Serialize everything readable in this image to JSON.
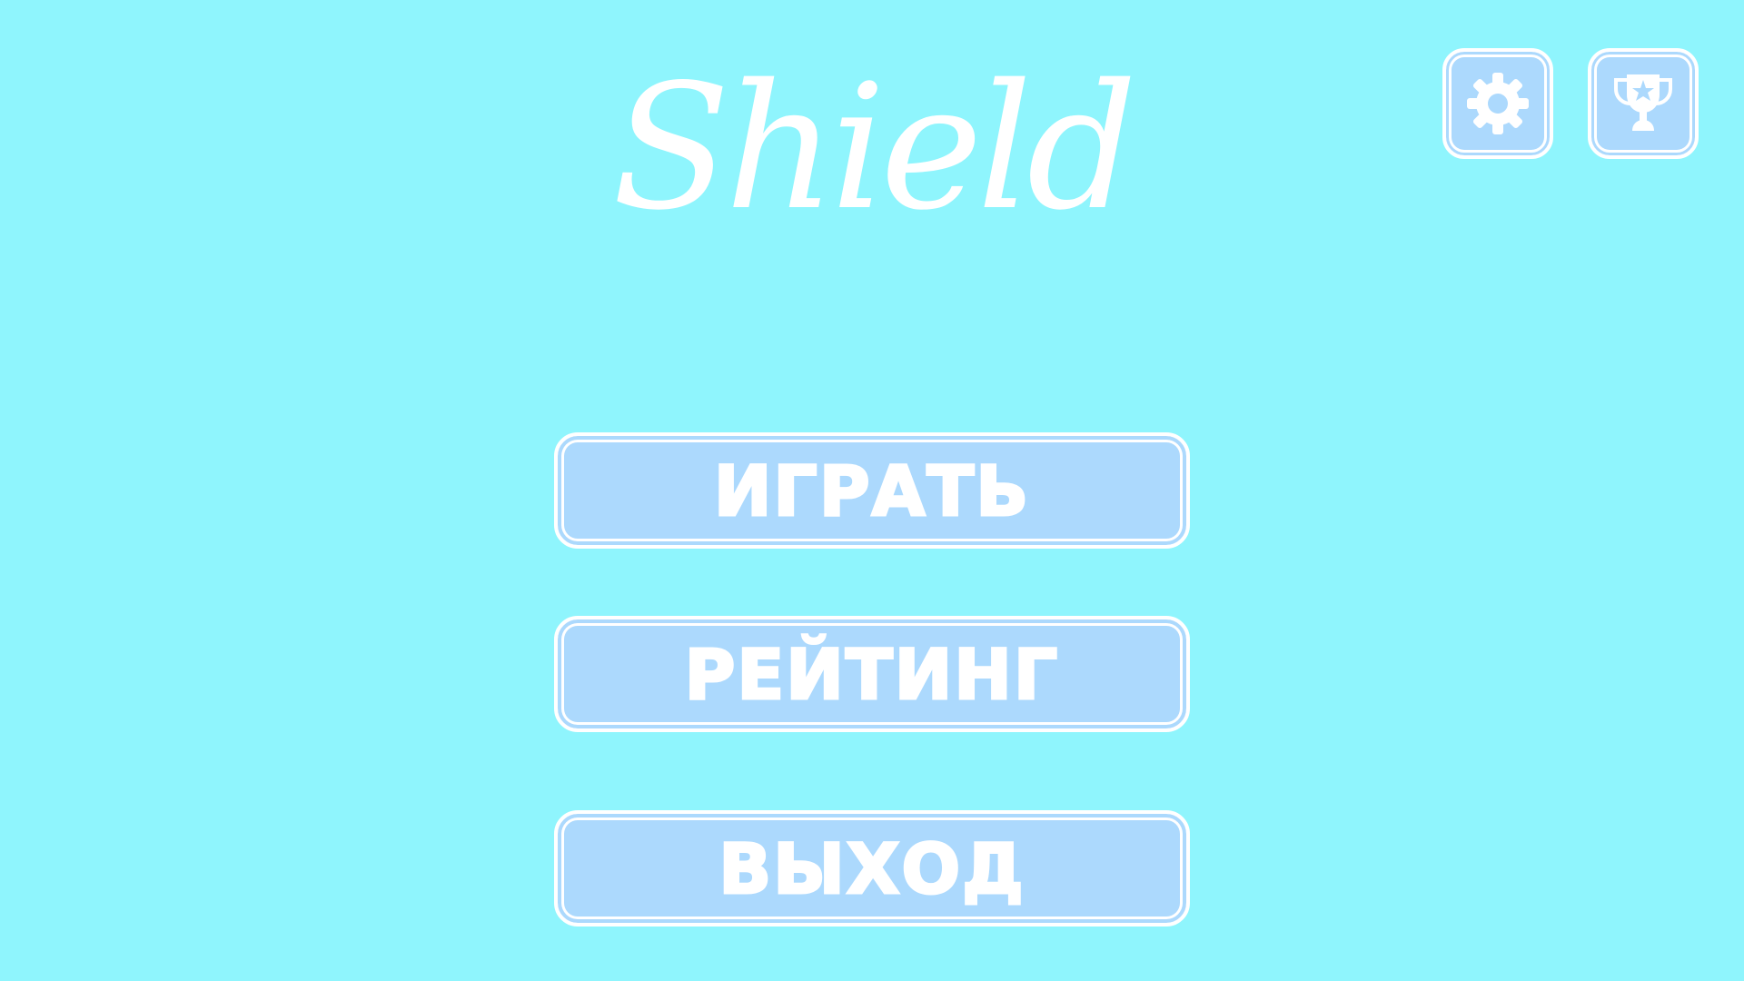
{
  "title": "Shield",
  "colors": {
    "background": "#8ff5fd",
    "button_fill": "#acd9fd",
    "border": "#ffffff",
    "text": "#ffffff"
  },
  "top_buttons": {
    "settings_icon": "gear-icon",
    "rating_icon": "trophy-icon"
  },
  "menu": {
    "play_label": "ИГРАТЬ",
    "rating_label": "РЕЙТИНГ",
    "exit_label": "ВЫХОД"
  }
}
